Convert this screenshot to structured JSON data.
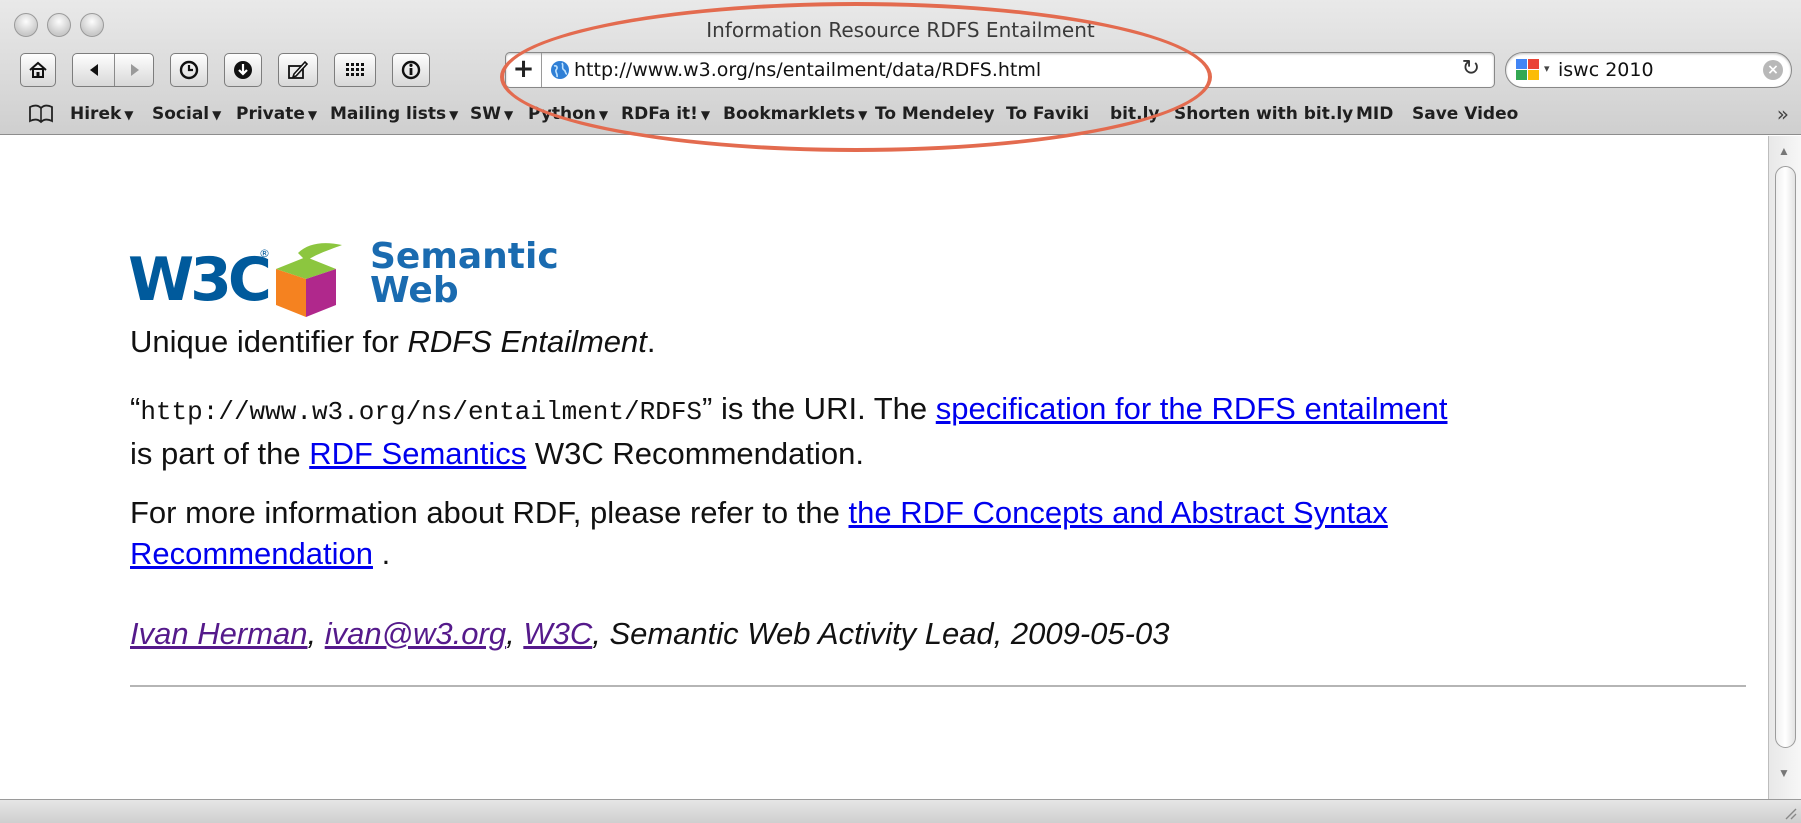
{
  "window": {
    "title": "Information Resource RDFS Entailment"
  },
  "toolbar": {
    "buttons": [
      "home-icon",
      "back-icon",
      "forward-icon",
      "history-icon",
      "downloads-icon",
      "edit-icon",
      "grid-icon",
      "info-icon"
    ],
    "address_add_label": "+",
    "url": "http://www.w3.org/ns/entailment/data/RDFS.html",
    "reload_label": "↻",
    "search_value": "iswc 2010",
    "search_clear_label": "×"
  },
  "bookmarks": [
    {
      "label": "Hirek",
      "menu": true
    },
    {
      "label": "Social",
      "menu": true
    },
    {
      "label": "Private",
      "menu": true
    },
    {
      "label": "Mailing lists",
      "menu": true
    },
    {
      "label": "SW",
      "menu": true
    },
    {
      "label": "Python",
      "menu": true
    },
    {
      "label": "RDFa it!",
      "menu": true
    },
    {
      "label": "Bookmarklets",
      "menu": true
    },
    {
      "label": "To Mendeley",
      "menu": false
    },
    {
      "label": "To Faviki",
      "menu": false
    },
    {
      "label": "bit.ly",
      "menu": false
    },
    {
      "label": "Shorten with bit.ly",
      "menu": false
    },
    {
      "label": "MID",
      "menu": false
    },
    {
      "label": "Save Video",
      "menu": false
    }
  ],
  "bookmarks_more_label": "»",
  "logo": {
    "w3c_text": "W3C",
    "registered": "®",
    "word_line1": "Semantic",
    "word_line2": "Web",
    "colors": {
      "w3c_blue": "#005a9c",
      "green": "#8cc63f",
      "orange": "#f58220",
      "purple": "#b0288c"
    }
  },
  "content": {
    "p1_prefix": "Unique identifier for ",
    "p1_em": "RDFS Entailment",
    "p1_suffix": ".",
    "p2_open_quote": "“",
    "p2_uri": "http://www.w3.org/ns/entailment/RDFS",
    "p2_close_quote": "”",
    "p2_mid": " is the URI. The ",
    "p2_link1": "specification for the RDFS entailment",
    "p2_mid2": " is part of the ",
    "p2_link2": "RDF Semantics",
    "p2_suffix": " W3C Recommendation.",
    "p3_prefix": "For more information about RDF, please refer to the ",
    "p3_link": "the RDF Concepts and Abstract Syntax Recommendation",
    "p3_suffix": " .",
    "footer_link1": "Ivan Herman",
    "footer_sep1": ", ",
    "footer_link2": "ivan@w3.org",
    "footer_sep2": ", ",
    "footer_link3": "W3C",
    "footer_suffix": ", Semantic Web Activity Lead, 2009-05-03"
  },
  "colors": {
    "link": "#0000ee",
    "visited_link": "#551a8b",
    "annotation": "#e36b4f"
  }
}
